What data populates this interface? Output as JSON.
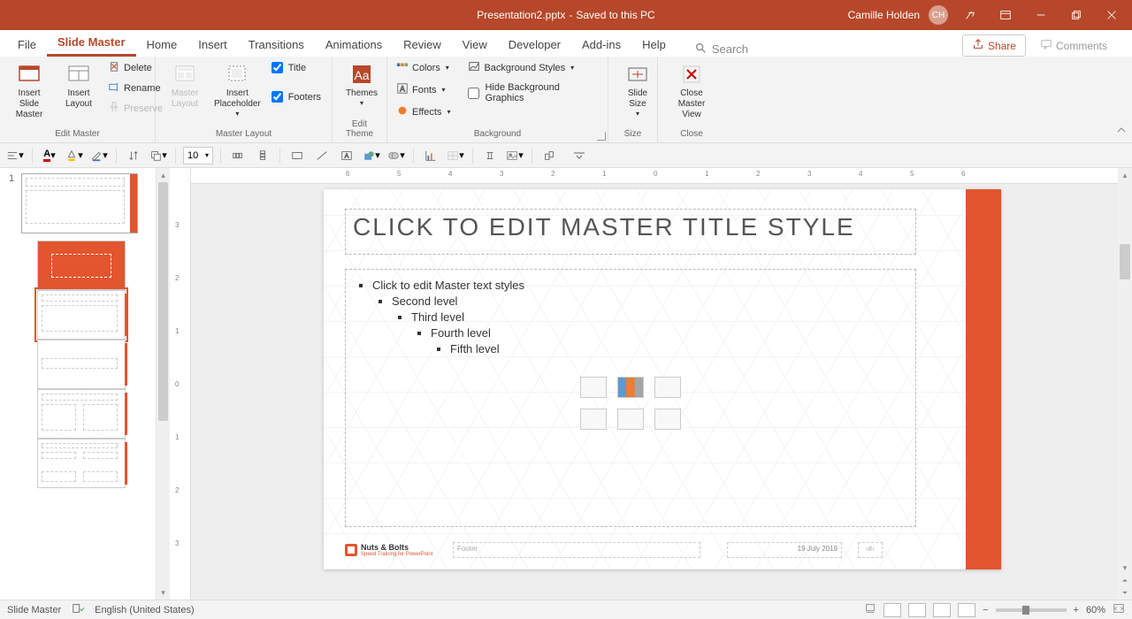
{
  "titlebar": {
    "filename": "Presentation2.pptx",
    "save_status": "Saved to this PC",
    "user_name": "Camille Holden",
    "user_initials": "CH"
  },
  "tabs": {
    "file": "File",
    "slide_master": "Slide Master",
    "home": "Home",
    "insert": "Insert",
    "transitions": "Transitions",
    "animations": "Animations",
    "review": "Review",
    "view": "View",
    "developer": "Developer",
    "addins": "Add-ins",
    "help": "Help",
    "search_placeholder": "Search",
    "share": "Share",
    "comments": "Comments"
  },
  "ribbon": {
    "edit_master": {
      "label": "Edit Master",
      "insert_slide_master": "Insert Slide\nMaster",
      "insert_layout": "Insert\nLayout",
      "delete": "Delete",
      "rename": "Rename",
      "preserve": "Preserve"
    },
    "master_layout": {
      "label": "Master Layout",
      "master_layout_btn": "Master\nLayout",
      "insert_placeholder": "Insert\nPlaceholder",
      "title_chk": "Title",
      "footers_chk": "Footers"
    },
    "edit_theme": {
      "label": "Edit Theme",
      "themes": "Themes"
    },
    "background": {
      "label": "Background",
      "colors": "Colors",
      "fonts": "Fonts",
      "effects": "Effects",
      "bg_styles": "Background Styles",
      "hide_bg": "Hide Background Graphics"
    },
    "size": {
      "label": "Size",
      "slide_size": "Slide\nSize"
    },
    "close": {
      "label": "Close",
      "close_master": "Close\nMaster View"
    }
  },
  "qat": {
    "font_size": "10"
  },
  "slide": {
    "title_placeholder": "Click to edit Master title style",
    "body_levels": {
      "l1": "Click to edit Master text styles",
      "l2": "Second level",
      "l3": "Third level",
      "l4": "Fourth level",
      "l5": "Fifth level"
    },
    "footer_text": "Footer",
    "date": "19 July 2019",
    "logo_name": "Nuts & Bolts",
    "logo_tag": "Speed Training for PowerPoint"
  },
  "thumbs": {
    "master_num": "1"
  },
  "status": {
    "mode": "Slide Master",
    "lang": "English (United States)",
    "zoom": "60%"
  },
  "ruler_ticks": [
    "6",
    "5",
    "4",
    "3",
    "2",
    "1",
    "0",
    "1",
    "2",
    "3",
    "4",
    "5",
    "6"
  ],
  "vruler_ticks": [
    "3",
    "2",
    "1",
    "0",
    "1",
    "2",
    "3"
  ]
}
